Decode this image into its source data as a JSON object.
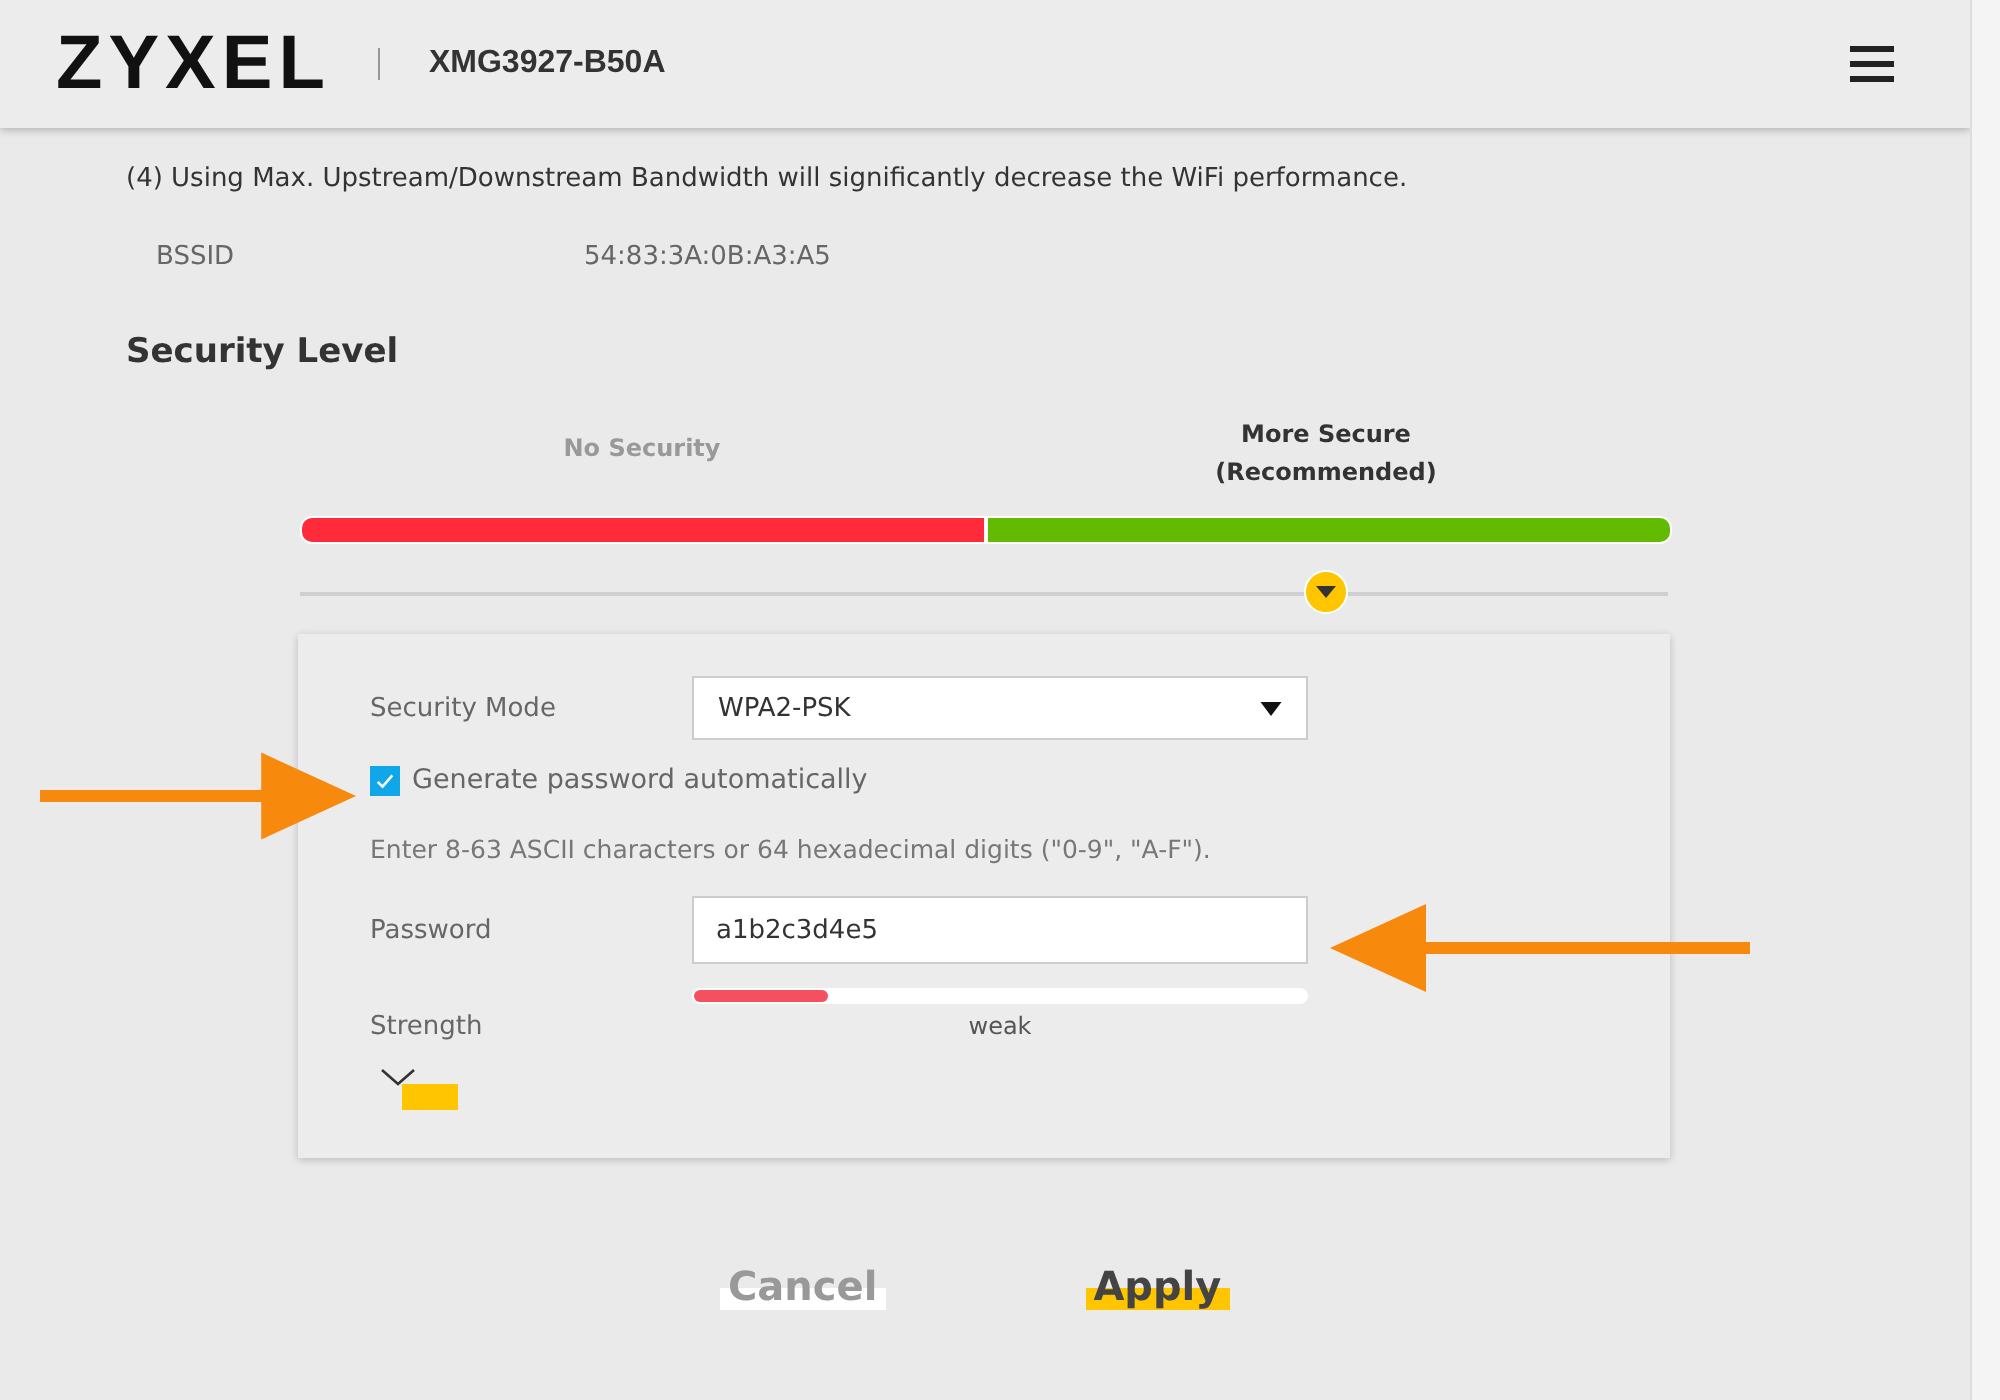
{
  "header": {
    "logo": "ZYXEL",
    "model": "XMG3927-B50A"
  },
  "note": "(4) Using Max. Upstream/Downstream Bandwidth will significantly decrease the WiFi performance.",
  "bssid": {
    "label": "BSSID",
    "value": "54:83:3A:0B:A3:A5"
  },
  "security_level": {
    "title": "Security Level",
    "levels": [
      {
        "label": "No Security",
        "selected": false,
        "color": "#ff2a3a"
      },
      {
        "label": "More Secure\n(Recommended)",
        "selected": true,
        "color": "#62bb00"
      }
    ]
  },
  "form": {
    "security_mode": {
      "label": "Security Mode",
      "value": "WPA2-PSK"
    },
    "auto_password": {
      "label": "Generate password automatically",
      "checked": true
    },
    "hint": "Enter 8-63 ASCII characters or 64 hexadecimal digits (\"0-9\", \"A-F\").",
    "password": {
      "label": "Password",
      "value": "a1b2c3d4e5"
    },
    "strength": {
      "label": "Strength",
      "level": 0.22,
      "reading": "weak"
    }
  },
  "buttons": [
    {
      "label": "Cancel",
      "kind": "secondary"
    },
    {
      "label": "Apply",
      "kind": "primary"
    }
  ]
}
